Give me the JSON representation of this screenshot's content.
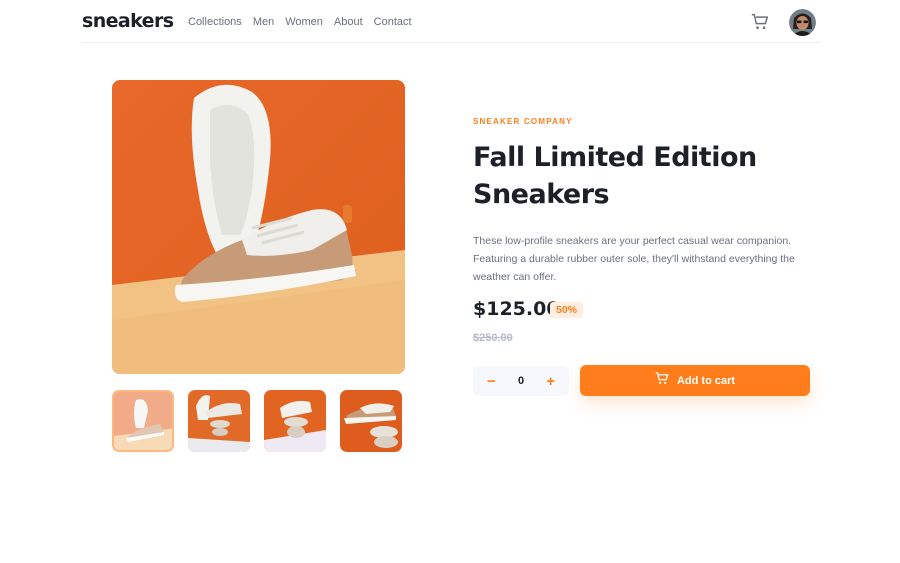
{
  "brand": {
    "logo": "sneakers"
  },
  "nav": {
    "items": [
      "Collections",
      "Men",
      "Women",
      "About",
      "Contact"
    ]
  },
  "header": {
    "cart_icon": "cart-icon",
    "avatar": "user-avatar"
  },
  "product": {
    "company": "SNEAKER COMPANY",
    "title": "Fall Limited Edition Sneakers",
    "description": "These low-profile sneakers are your perfect casual wear companion. Featuring a durable rubber outer sole, they'll withstand everything the weather can offer.",
    "price": "$125.00",
    "discount": "50%",
    "original_price": "$250.00"
  },
  "gallery": {
    "thumbnail_count": 4,
    "active_thumbnail": 1
  },
  "quantity": {
    "minus": "−",
    "value": "0",
    "plus": "+"
  },
  "cart_button": {
    "label": "Add to cart",
    "icon": "cart-icon"
  },
  "colors": {
    "accent": "#ff7e1b",
    "accent_pale": "#ffede0",
    "text_dark": "#1d2026",
    "text_gray": "#69707d",
    "strike_gray": "#b6bcc8"
  }
}
